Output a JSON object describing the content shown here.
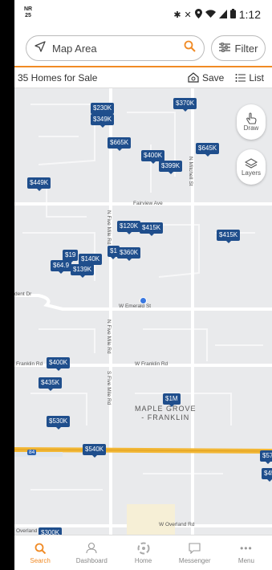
{
  "status": {
    "left_top": "NR",
    "left_bottom": "25",
    "time": "1:12"
  },
  "search": {
    "placeholder": "Map Area",
    "filter_label": "Filter"
  },
  "subbar": {
    "count": "35 Homes for Sale",
    "save_label": "Save",
    "list_label": "List"
  },
  "map_buttons": {
    "draw": "Draw",
    "layers": "Layers"
  },
  "pins": [
    "$230K",
    "$349K",
    "$370K",
    "$665K",
    "$400K",
    "$399K",
    "$645K",
    "$449K",
    "$120K",
    "$415K",
    "$415K",
    "$19",
    "$140K",
    "$1",
    "$360K",
    "$64.9",
    "$139K",
    "$400K",
    "$435K",
    "$530K",
    "$1M",
    "$540K",
    "$57",
    "$45",
    "$300K"
  ],
  "road_labels": {
    "fairview": "Fairview Ave",
    "n_five_mile": "N Five Mile Rd",
    "n_mitchell": "N Mitchell St",
    "emerald": "W Emerald St",
    "s_five_mile": "S Five Mile Rd",
    "n_five_mile_2": "N Five Mile Rd",
    "franklin_w": "W Franklin Rd",
    "franklin": "Franklin Rd",
    "overland_w": "W Overland Rd",
    "overland": "Overland Rd",
    "dent": "dent Dr",
    "i84": "84"
  },
  "area_label": {
    "line1": "MAPLE GROVE",
    "line2": "- FRANKLIN"
  },
  "nav": [
    {
      "label": "Search"
    },
    {
      "label": "Dashboard"
    },
    {
      "label": "Home"
    },
    {
      "label": "Messenger"
    },
    {
      "label": "Menu"
    }
  ],
  "colors": {
    "accent": "#f08a24",
    "pin": "#1f4e8c",
    "highway": "#f2b735"
  }
}
